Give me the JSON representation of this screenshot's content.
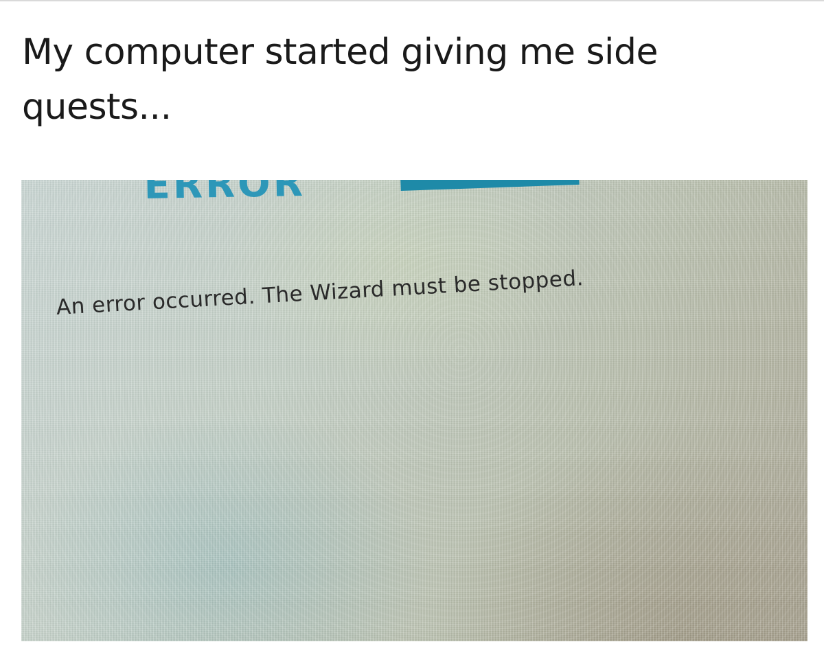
{
  "post": {
    "caption": "My computer started giving me side quests..."
  },
  "screen": {
    "heading": "ERROR",
    "message": "An error occurred. The Wizard must be stopped.",
    "colors": {
      "heading": "#2d97b8",
      "title_bar": "#1e8aa8"
    }
  }
}
